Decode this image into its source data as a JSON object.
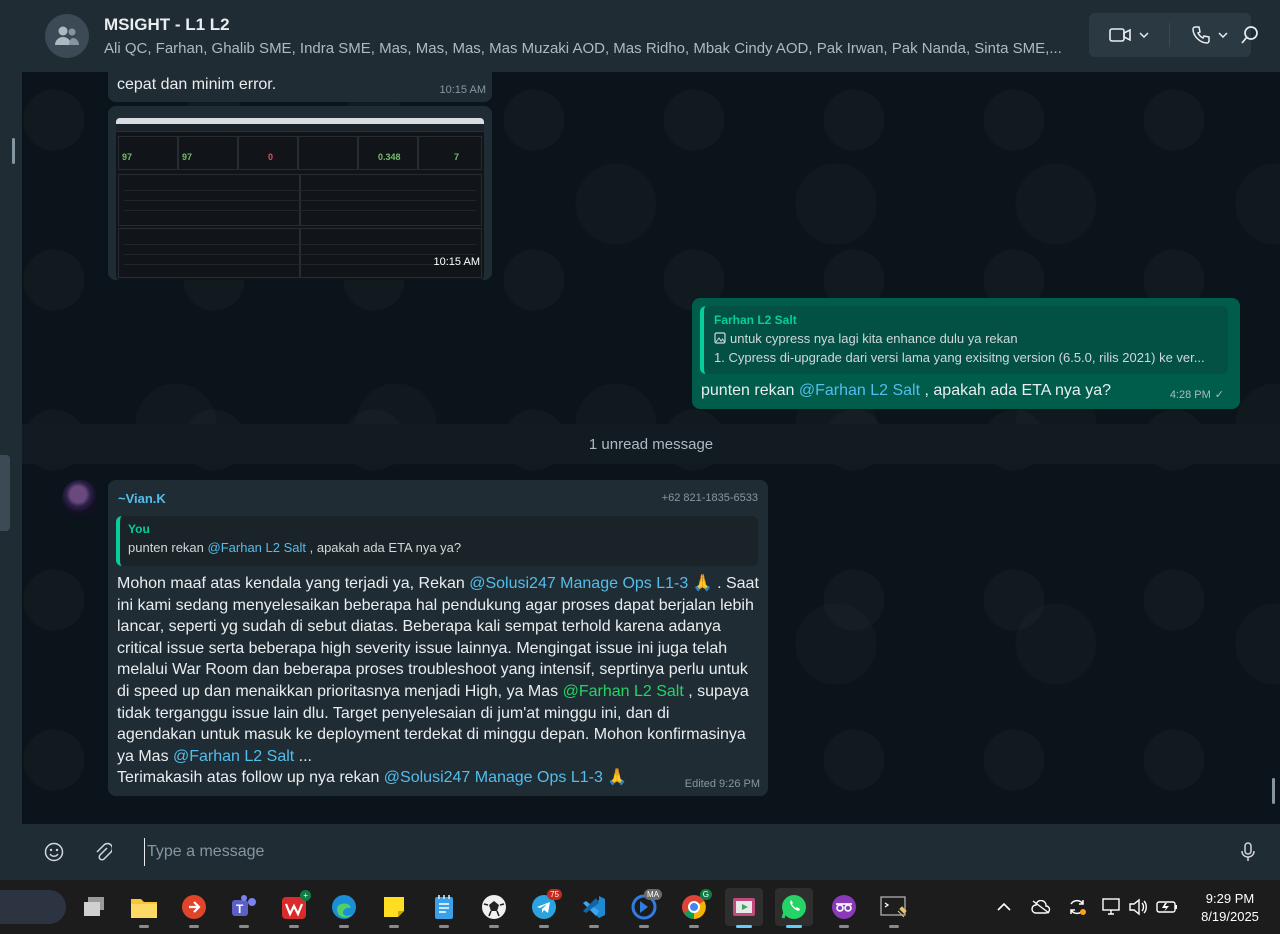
{
  "header": {
    "title": "MSIGHT - L1 L2",
    "members": "Ali QC, Farhan, Ghalib SME, Indra SME, Mas, Mas, Mas, Mas Muzaki AOD, Mas Ridho, Mbak Cindy AOD, Pak Irwan, Pak Nanda, Sinta SME,..."
  },
  "messages": {
    "m1": {
      "text": "cepat dan minim error.",
      "time": "10:15 AM"
    },
    "m2": {
      "time": "10:15 AM",
      "screenshot_numbers": [
        "97",
        "97",
        "0",
        "0.348",
        "7"
      ]
    },
    "m3": {
      "quote_name": "Farhan L2 Salt",
      "quote_line1": "untuk cypress nya lagi kita enhance dulu ya rekan",
      "quote_line2": "1. Cypress di-upgrade dari versi lama yang exisitng version (6.5.0, rilis 2021) ke ver...",
      "text_pre": "punten rekan ",
      "mention": "@Farhan L2 Salt",
      "text_post": " , apakah ada ETA nya ya?",
      "time": "4:28 PM",
      "status": "✓"
    },
    "unread": "1 unread message",
    "m4": {
      "sender": "~Vian.K",
      "phone": "+62 821-1835-6533",
      "quote_name": "You",
      "quote_pre": "punten rekan ",
      "quote_mention": "@Farhan L2 Salt",
      "quote_post": " , apakah ada ETA nya ya?",
      "l1_pre": "Mohon maaf atas kendala yang terjadi ya, Rekan ",
      "l1_mention": "@Solusi247 Manage Ops L1-3",
      "l1_post": " 🙏 . Saat",
      "l2": "ini kami sedang menyelesaikan beberapa hal pendukung agar proses dapat berjalan lebih",
      "l3": "lancar, seperti yg sudah di sebut diatas. Beberapa kali sempat terhold karena adanya",
      "l4": "critical issue serta beberapa high severity issue lainnya. Mengingat issue ini juga telah",
      "l5": "melalui War Room dan beberapa proses troubleshoot yang intensif, seprtinya perlu untuk",
      "l6_pre": "di speed up dan menaikkan prioritasnya menjadi High, ya Mas ",
      "l6_mention": "@Farhan L2 Salt",
      "l6_post": " , supaya",
      "l7": "tidak terganggu issue lain dlu. Target penyelesaian di jum'at minggu ini, dan di",
      "l8": "agendakan untuk masuk ke deployment terdekat di minggu depan. Mohon konfirmasinya",
      "l9_pre": "ya Mas ",
      "l9_mention": "@Farhan L2 Salt",
      "l9_post": " ...",
      "l10_pre": "Terimakasih atas follow up nya rekan ",
      "l10_mention": "@Solusi247 Manage Ops L1-3",
      "l10_post": " 🙏",
      "edited": "Edited 9:26 PM"
    }
  },
  "composer": {
    "placeholder": "Type a message"
  },
  "taskbar": {
    "badges": {
      "telegram": "75",
      "g": "G",
      "ma": "MA"
    },
    "time": "9:29 PM",
    "date": "8/19/2025"
  },
  "icons": [
    "group-icon",
    "video-icon",
    "phone-icon",
    "search-icon",
    "image-icon",
    "emoji-icon",
    "attach-icon",
    "mic-icon"
  ],
  "colors": {
    "accent": "#06cf9c",
    "mention": "#53bdeb",
    "outgoing_bubble": "#005c4b",
    "incoming_bubble": "#202c33"
  }
}
